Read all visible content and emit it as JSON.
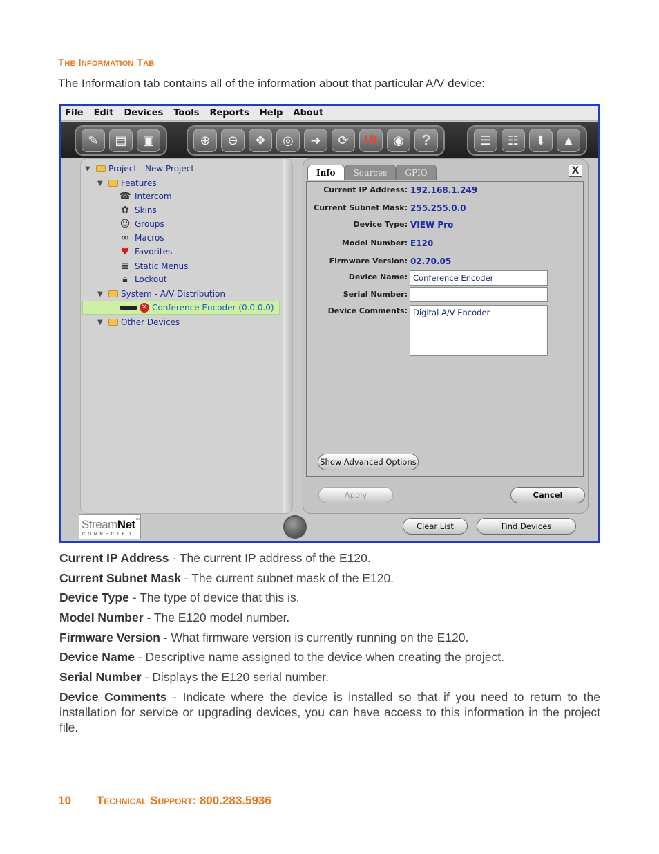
{
  "section_title": "The Information Tab",
  "intro": "The Information tab contains all of the information about that particular A/V device:",
  "app": {
    "menu": [
      "File",
      "Edit",
      "Devices",
      "Tools",
      "Reports",
      "Help",
      "About"
    ],
    "toolbar": {
      "ir_label": "IR",
      "help_label": "?"
    },
    "tree": {
      "project": "Project - New Project",
      "features": "Features",
      "intercom": "Intercom",
      "skins": "Skins",
      "groups": "Groups",
      "macros": "Macros",
      "favorites": "Favorites",
      "static_menus": "Static Menus",
      "lockout": "Lockout",
      "system": "System - A/V Distribution",
      "device": "Conference Encoder (0.0.0.0)",
      "other_devices": "Other Devices"
    },
    "tabs": {
      "info": "Info",
      "sources": "Sources",
      "gpio": "GPIO"
    },
    "close_label": "X",
    "info": {
      "ip_label": "Current IP Address:",
      "ip_value": "192.168.1.249",
      "subnet_label": "Current Subnet Mask:",
      "subnet_value": "255.255.0.0",
      "type_label": "Device Type:",
      "type_value": "VIEW Pro",
      "model_label": "Model Number:",
      "model_value": "E120",
      "firmware_label": "Firmware Version:",
      "firmware_value": "02.70.05",
      "name_label": "Device Name:",
      "name_value": "Conference Encoder",
      "serial_label": "Serial Number:",
      "serial_value": "",
      "comments_label": "Device Comments:",
      "comments_value": "Digital A/V Encoder"
    },
    "buttons": {
      "advanced": "Show Advanced Options",
      "apply": "Apply",
      "cancel": "Cancel",
      "clear": "Clear List",
      "find": "Find Devices"
    },
    "logo": {
      "stream": "Stream",
      "net": "Net",
      "tm": "™",
      "connected": "CONNECTED"
    }
  },
  "descriptions": [
    {
      "term": "Current IP Address",
      "text": "  - The current IP address of the E120."
    },
    {
      "term": "Current Subnet Mask",
      "text": "  - The current subnet mask of the E120."
    },
    {
      "term": "Device Type",
      "text": "  - The type of device that this is."
    },
    {
      "term": "Model Number",
      "text": " - The E120 model number."
    },
    {
      "term": "Firmware Version",
      "text": "  - What firmware version is currently running on the E120."
    },
    {
      "term": "Device Name",
      "text": " - Descriptive name assigned to the device when creating the project."
    },
    {
      "term": "Serial Number",
      "text": " - Displays the E120 serial number."
    },
    {
      "term": "Device Comments",
      "text": " - Indicate where the device is installed so that if you need to return to the installation for service or upgrading devices, you can have access to this information in the project file."
    }
  ],
  "footer": {
    "page": "10",
    "label": "Technical Support:",
    "phone": "800.283.5936"
  }
}
